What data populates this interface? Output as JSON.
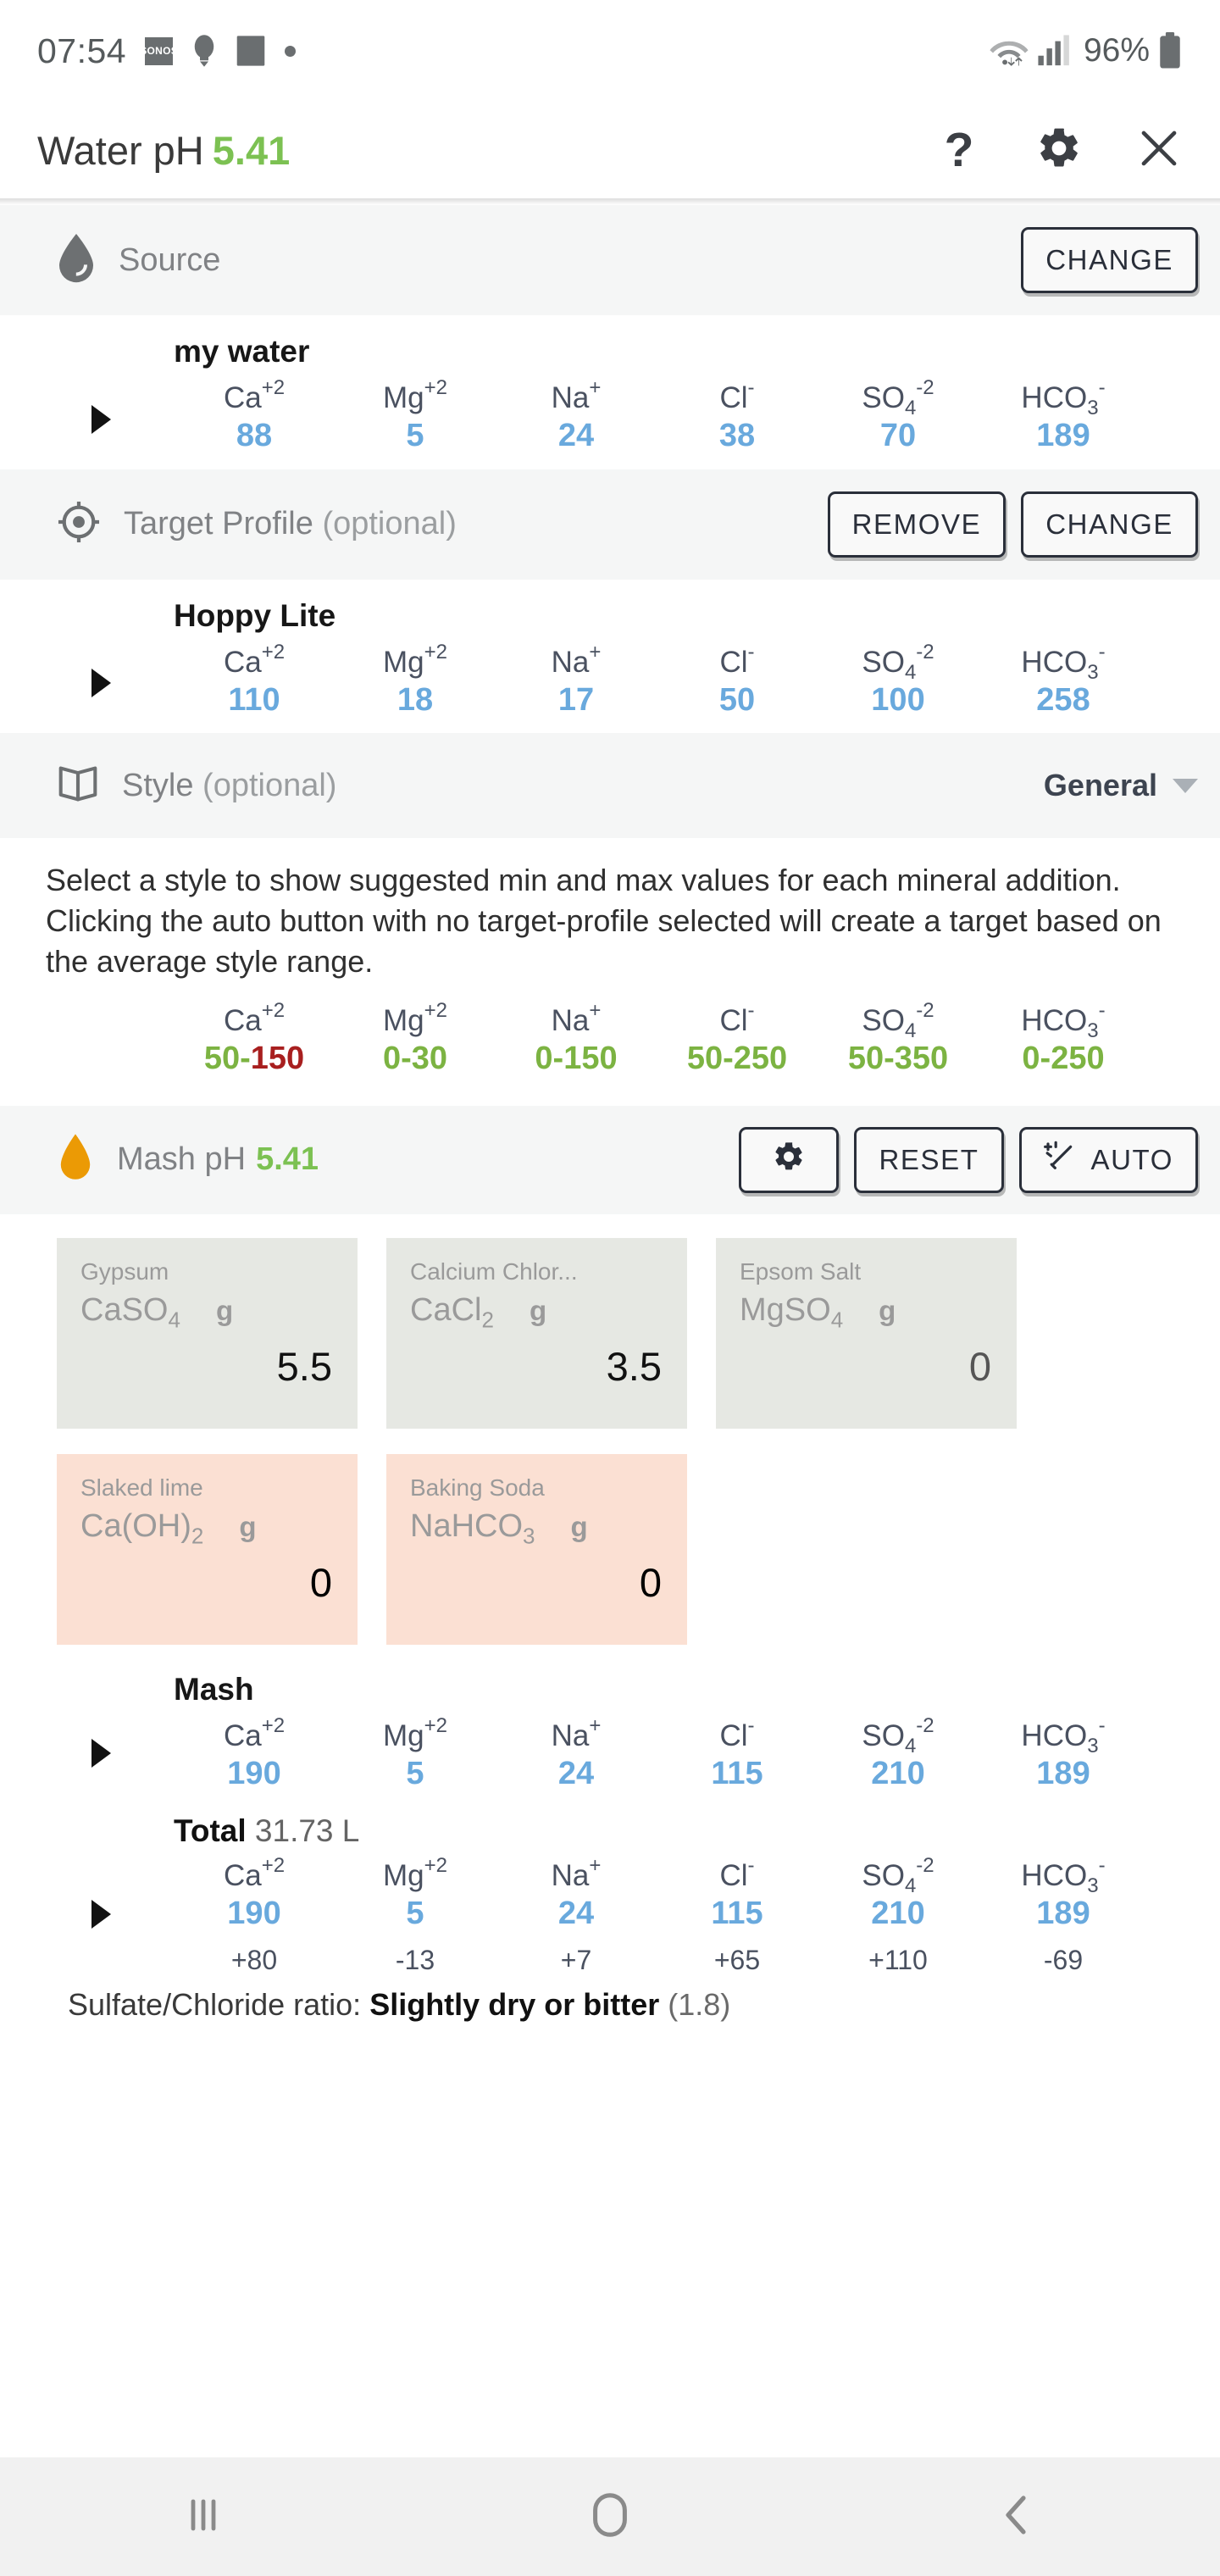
{
  "status_bar": {
    "time": "07:54",
    "sonos_label": "SONOS",
    "icons": [
      "sonos-icon",
      "bulb-icon",
      "image-icon",
      "dot-icon",
      "wifi-icon",
      "signal-icon",
      "battery-icon"
    ],
    "battery": "96%"
  },
  "app_bar": {
    "title": "Water pH",
    "ph_value": "5.41",
    "help_label": "?",
    "icons": [
      "help-icon",
      "gear-icon",
      "close-icon"
    ]
  },
  "ions": {
    "symbols": [
      {
        "base": "Ca",
        "sup": "+2",
        "sub": ""
      },
      {
        "base": "Mg",
        "sup": "+2",
        "sub": ""
      },
      {
        "base": "Na",
        "sup": "+",
        "sub": ""
      },
      {
        "base": "Cl",
        "sup": "-",
        "sub": ""
      },
      {
        "base": "SO",
        "sup": "-2",
        "sub": "4"
      },
      {
        "base": "HCO",
        "sup": "-",
        "sub": "3"
      }
    ],
    "labels": [
      "Ca+2",
      "Mg+2",
      "Na+",
      "Cl-",
      "SO4-2",
      "HCO3-"
    ]
  },
  "source": {
    "title": "Source",
    "change_label": "CHANGE",
    "profile_name": "my water",
    "values": [
      "88",
      "5",
      "24",
      "38",
      "70",
      "189"
    ]
  },
  "target_profile": {
    "title": "Target Profile",
    "optional": " (optional)",
    "remove_label": "REMOVE",
    "change_label": "CHANGE",
    "profile_name": "Hoppy Lite",
    "values": [
      "110",
      "18",
      "17",
      "50",
      "100",
      "258"
    ]
  },
  "style": {
    "title": "Style",
    "optional": " (optional)",
    "selected": "General",
    "description": "Select a style to show suggested min and max values for each mineral addition. Clicking the auto button with no target-profile selected will create a target based on the average style range.",
    "ranges": [
      {
        "min": "50",
        "max": "150",
        "min_color": "green",
        "max_color": "red"
      },
      {
        "min": "0",
        "max": "30",
        "min_color": "green",
        "max_color": "green"
      },
      {
        "min": "0",
        "max": "150",
        "min_color": "green",
        "max_color": "green"
      },
      {
        "min": "50",
        "max": "250",
        "min_color": "green",
        "max_color": "green"
      },
      {
        "min": "50",
        "max": "350",
        "min_color": "green",
        "max_color": "green"
      },
      {
        "min": "0",
        "max": "250",
        "min_color": "green",
        "max_color": "green"
      }
    ]
  },
  "mash_bar": {
    "title": "Mash pH",
    "ph_value": "5.41",
    "gear_label": "",
    "reset_label": "RESET",
    "auto_label": "AUTO"
  },
  "additions": [
    {
      "name": "Gypsum",
      "formula_main": "CaSO",
      "formula_sub": "4",
      "formula_tail": "",
      "unit": "g",
      "value": "5.5",
      "tone": "grey"
    },
    {
      "name": "Calcium Chlor...",
      "formula_main": "CaCl",
      "formula_sub": "2",
      "formula_tail": "",
      "unit": "g",
      "value": "3.5",
      "tone": "grey"
    },
    {
      "name": "Epsom Salt",
      "formula_main": "MgSO",
      "formula_sub": "4",
      "formula_tail": "",
      "unit": "g",
      "value": "0",
      "tone": "grey"
    },
    {
      "name": "Slaked lime",
      "formula_main": "Ca(OH)",
      "formula_sub": "2",
      "formula_tail": "",
      "unit": "g",
      "value": "0",
      "tone": "pink"
    },
    {
      "name": "Baking Soda",
      "formula_main": "NaHCO",
      "formula_sub": "3",
      "formula_tail": "",
      "unit": "g",
      "value": "0",
      "tone": "pink"
    }
  ],
  "mash_result": {
    "label": "Mash",
    "values": [
      "190",
      "5",
      "24",
      "115",
      "210",
      "189"
    ]
  },
  "total_result": {
    "label": "Total",
    "volume": "31.73 L",
    "values": [
      "190",
      "5",
      "24",
      "115",
      "210",
      "189"
    ],
    "deltas": [
      "+80",
      "-13",
      "+7",
      "+65",
      "+110",
      "-69"
    ]
  },
  "ratio": {
    "prefix": "Sulfate/Chloride ratio: ",
    "verdict": "Slightly dry or bitter",
    "value": " (1.8)"
  },
  "nav_bar": {
    "recents_label": "recents-icon",
    "home_label": "home-icon",
    "back_label": "back-icon"
  },
  "colors": {
    "accent_green": "#7cc152",
    "ion_blue": "#69a9dd",
    "range_green": "#7cb342",
    "range_red": "#a81f1f",
    "strip_bg": "#f5f6f6",
    "card_grey": "#e6e8e3",
    "card_pink": "#fbe0d3",
    "drop_orange": "#eb9a05"
  }
}
